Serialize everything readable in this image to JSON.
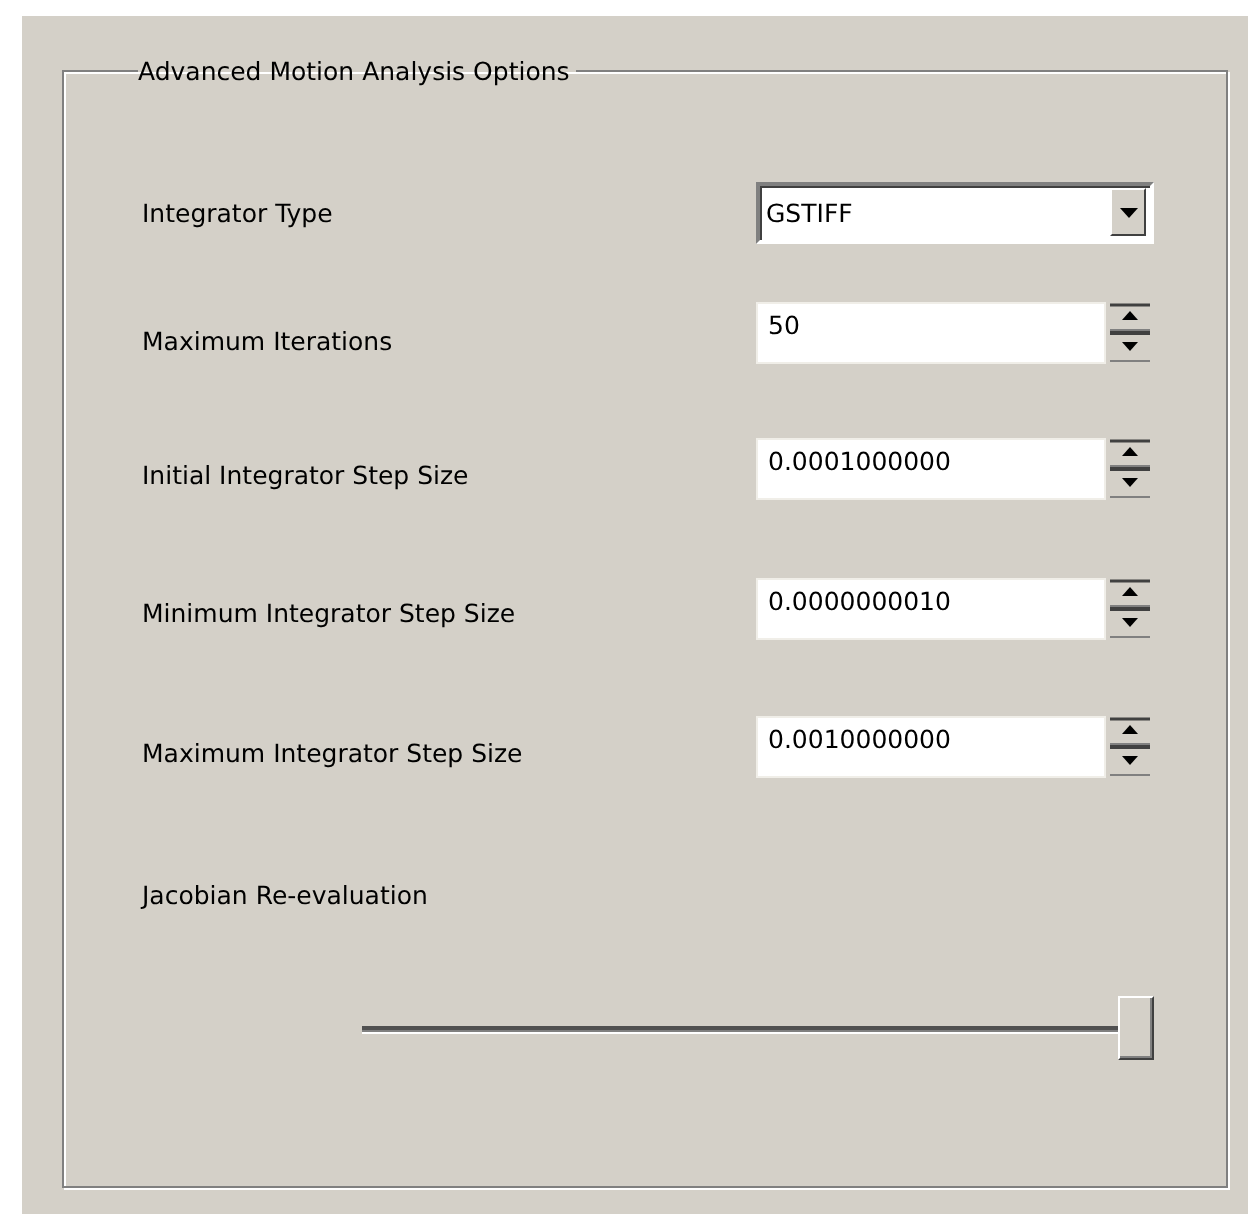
{
  "group": {
    "title": "Advanced Motion Analysis Options"
  },
  "fields": [
    {
      "kind": "dropdown",
      "label": "Integrator Type",
      "value": "GSTIFF"
    },
    {
      "kind": "spin",
      "label": "Maximum Iterations",
      "value": "50"
    },
    {
      "kind": "spin",
      "label": "Initial Integrator Step Size",
      "value": "0.0001000000"
    },
    {
      "kind": "spin",
      "label": "Minimum Integrator Step Size",
      "value": "0.0000000010"
    },
    {
      "kind": "spin",
      "label": "Maximum Integrator Step Size",
      "value": "0.0010000000"
    }
  ],
  "slider": {
    "label": "Jacobian Re-evaluation",
    "level": 1
  }
}
